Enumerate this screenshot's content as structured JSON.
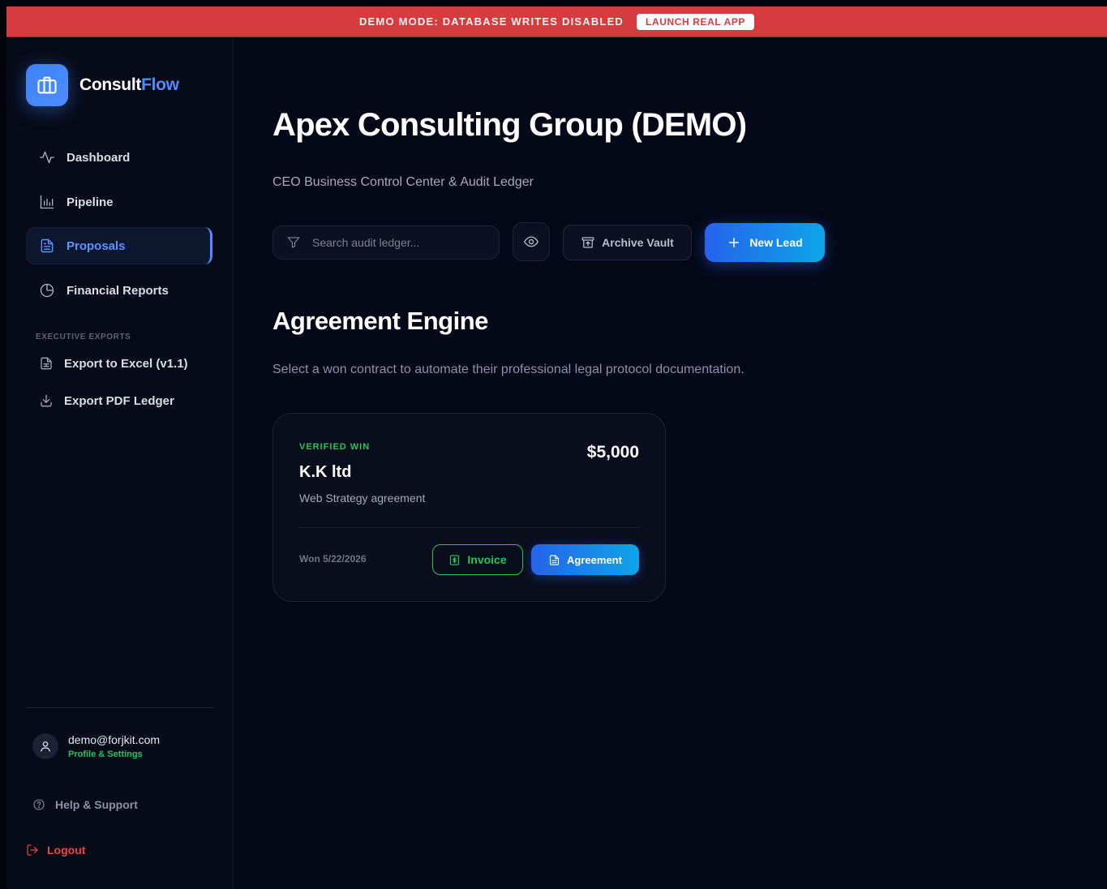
{
  "demo_banner": {
    "text": "DEMO MODE: DATABASE WRITES DISABLED",
    "button": "LAUNCH REAL APP",
    "color": "#d63b3f"
  },
  "brand": {
    "name_part1": "Consult",
    "name_part2": "Flow",
    "accent": "#4f8dff",
    "icon": "briefcase-icon"
  },
  "sidebar": {
    "nav": [
      {
        "label": "Dashboard",
        "icon": "activity-icon",
        "active": false
      },
      {
        "label": "Pipeline",
        "icon": "bar-chart-icon",
        "active": false
      },
      {
        "label": "Proposals",
        "icon": "document-icon",
        "active": true
      },
      {
        "label": "Financial Reports",
        "icon": "pie-chart-icon",
        "active": false
      }
    ],
    "section_label": "EXECUTIVE EXPORTS",
    "exports": [
      {
        "label": "Export to Excel (v1.1)",
        "icon": "spreadsheet-icon"
      },
      {
        "label": "Export PDF Ledger",
        "icon": "download-icon"
      }
    ],
    "user": {
      "email": "demo@forjkit.com",
      "link": "Profile & Settings"
    },
    "help": "Help & Support",
    "logout": "Logout"
  },
  "main": {
    "title": "Apex Consulting Group (DEMO)",
    "subtitle": "CEO Business Control Center & Audit Ledger",
    "search_placeholder": "Search audit ledger...",
    "archive_label": "Archive Vault",
    "new_lead_label": "New Lead",
    "section_title": "Agreement Engine",
    "section_desc": "Select a won contract to automate their professional legal protocol documentation."
  },
  "card": {
    "status": "VERIFIED WIN",
    "amount": "$5,000",
    "client": "K.K ltd",
    "description": "Web Strategy agreement",
    "won_date": "Won 5/22/2026",
    "invoice_label": "Invoice",
    "agreement_label": "Agreement",
    "status_color": "#22c55e"
  }
}
